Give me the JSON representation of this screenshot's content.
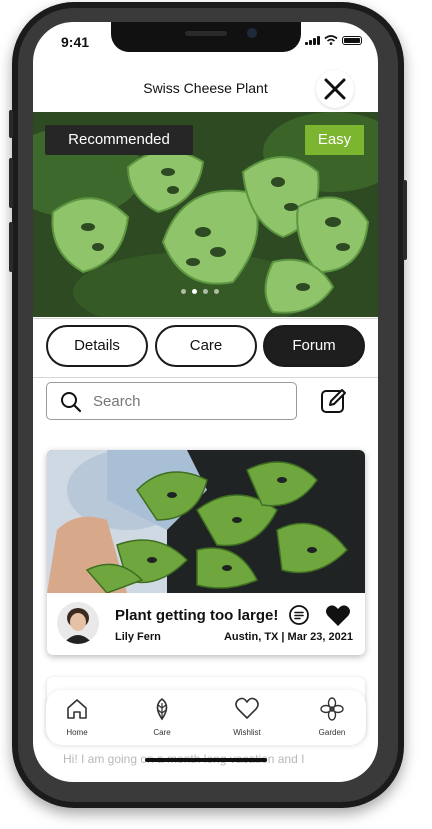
{
  "status_bar": {
    "time": "9:41"
  },
  "header": {
    "title": "Swiss Cheese Plant"
  },
  "hero": {
    "badge_left": "Recommended",
    "badge_right": "Easy",
    "badge_right_color": "#7cb52f",
    "active_slide": 1,
    "slide_count": 4
  },
  "tabs": [
    {
      "label": "Details",
      "active": false
    },
    {
      "label": "Care",
      "active": false
    },
    {
      "label": "Forum",
      "active": true
    }
  ],
  "search": {
    "placeholder": "Search"
  },
  "post": {
    "title": "Plant getting too large!",
    "author": "Lily Fern",
    "meta": "Austin, TX | Mar 23, 2021"
  },
  "next_post_preview": "Hi! I am going on a month long vacation and I",
  "bottom_nav": [
    {
      "label": "Home",
      "icon": "home-icon"
    },
    {
      "label": "Care",
      "icon": "leaf-icon"
    },
    {
      "label": "Wishlist",
      "icon": "heart-outline-icon"
    },
    {
      "label": "Garden",
      "icon": "flower-icon"
    }
  ]
}
